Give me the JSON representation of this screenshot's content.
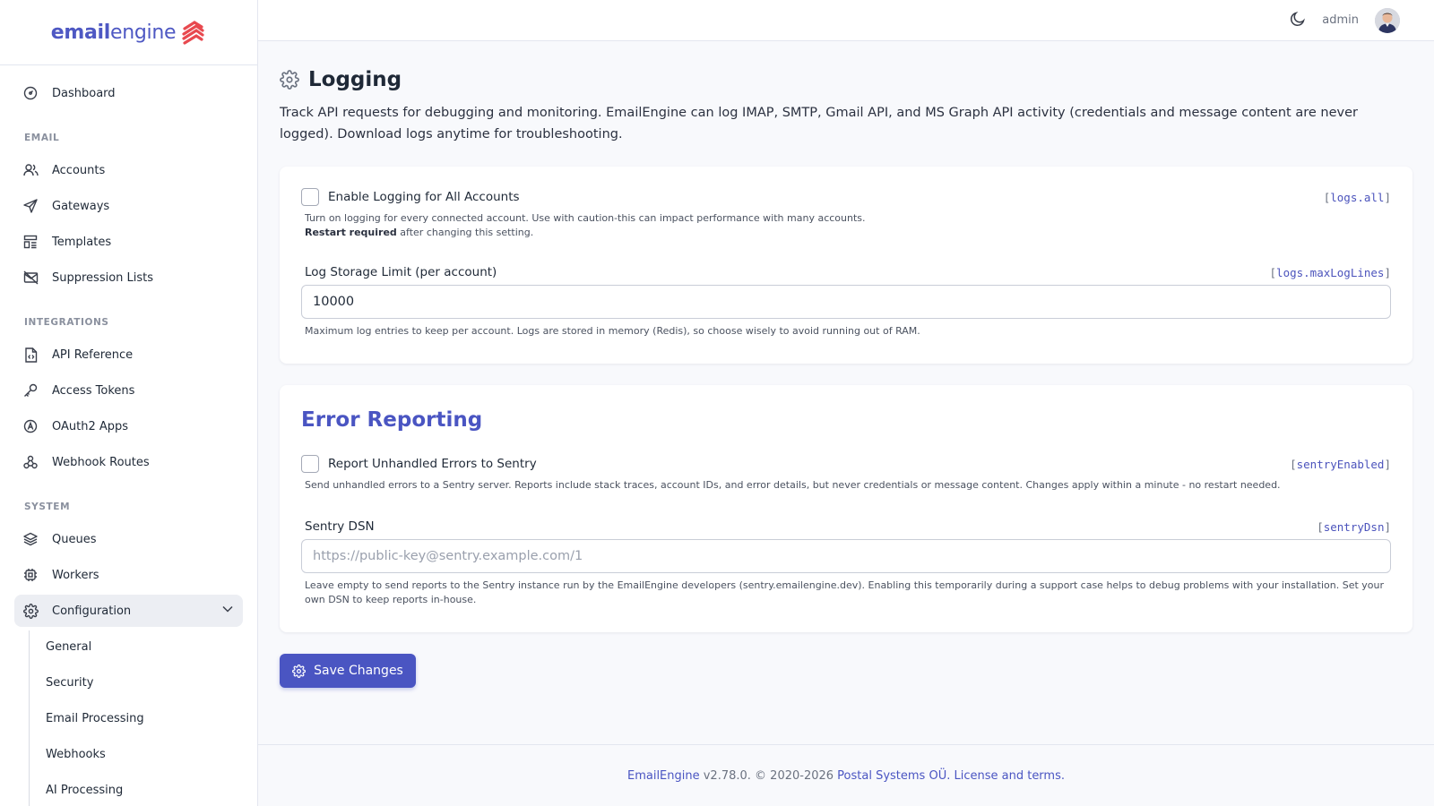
{
  "brand": {
    "part1": "email",
    "part2": "engine"
  },
  "sidebar": {
    "top": [
      {
        "label": "Dashboard",
        "icon": "dashboard-icon"
      }
    ],
    "sections": [
      {
        "title": "EMAIL",
        "items": [
          {
            "label": "Accounts",
            "icon": "users-icon"
          },
          {
            "label": "Gateways",
            "icon": "send-icon"
          },
          {
            "label": "Templates",
            "icon": "template-icon"
          },
          {
            "label": "Suppression Lists",
            "icon": "mail-off-icon"
          }
        ]
      },
      {
        "title": "INTEGRATIONS",
        "items": [
          {
            "label": "API Reference",
            "icon": "file-code-icon"
          },
          {
            "label": "Access Tokens",
            "icon": "key-icon"
          },
          {
            "label": "OAuth2 Apps",
            "icon": "oauth-icon"
          },
          {
            "label": "Webhook Routes",
            "icon": "webhook-icon"
          }
        ]
      },
      {
        "title": "SYSTEM",
        "items": [
          {
            "label": "Queues",
            "icon": "layers-icon"
          },
          {
            "label": "Workers",
            "icon": "cpu-icon"
          },
          {
            "label": "Configuration",
            "icon": "gear-icon",
            "active": true
          }
        ]
      }
    ],
    "subitems": [
      "General",
      "Security",
      "Email Processing",
      "Webhooks",
      "AI Processing"
    ]
  },
  "topbar": {
    "user": "admin"
  },
  "page": {
    "title": "Logging",
    "description": "Track API requests for debugging and monitoring. EmailEngine can log IMAP, SMTP, Gmail API, and MS Graph API activity (credentials and message content are never logged). Download logs anytime for troubleshooting."
  },
  "logging": {
    "enable_label": "Enable Logging for All Accounts",
    "enable_key": "logs.all",
    "enable_help": "Turn on logging for every connected account. Use with caution-this can impact performance with many accounts.",
    "restart_bold": "Restart required",
    "restart_rest": " after changing this setting.",
    "limit_label": "Log Storage Limit (per account)",
    "limit_key": "logs.maxLogLines",
    "limit_value": "10000",
    "limit_help": "Maximum log entries to keep per account. Logs are stored in memory (Redis), so choose wisely to avoid running out of RAM."
  },
  "error_reporting": {
    "title": "Error Reporting",
    "sentry_label": "Report Unhandled Errors to Sentry",
    "sentry_key": "sentryEnabled",
    "sentry_help": "Send unhandled errors to a Sentry server. Reports include stack traces, account IDs, and error details, but never credentials or message content. Changes apply within a minute - no restart needed.",
    "dsn_label": "Sentry DSN",
    "dsn_key": "sentryDsn",
    "dsn_placeholder": "https://public-key@sentry.example.com/1",
    "dsn_help": "Leave empty to send reports to the Sentry instance run by the EmailEngine developers (sentry.emailengine.dev). Enabling this temporarily during a support case helps to debug problems with your installation. Set your own DSN to keep reports in-house."
  },
  "save_label": "Save Changes",
  "footer": {
    "product": "EmailEngine",
    "version": " v2.78.0. © 2020-2026 ",
    "company": "Postal Systems OÜ",
    "sep": ". ",
    "license": "License and terms",
    "end": "."
  },
  "colors": {
    "accent": "#4a55c2",
    "brand_mark": "#e8494f"
  }
}
